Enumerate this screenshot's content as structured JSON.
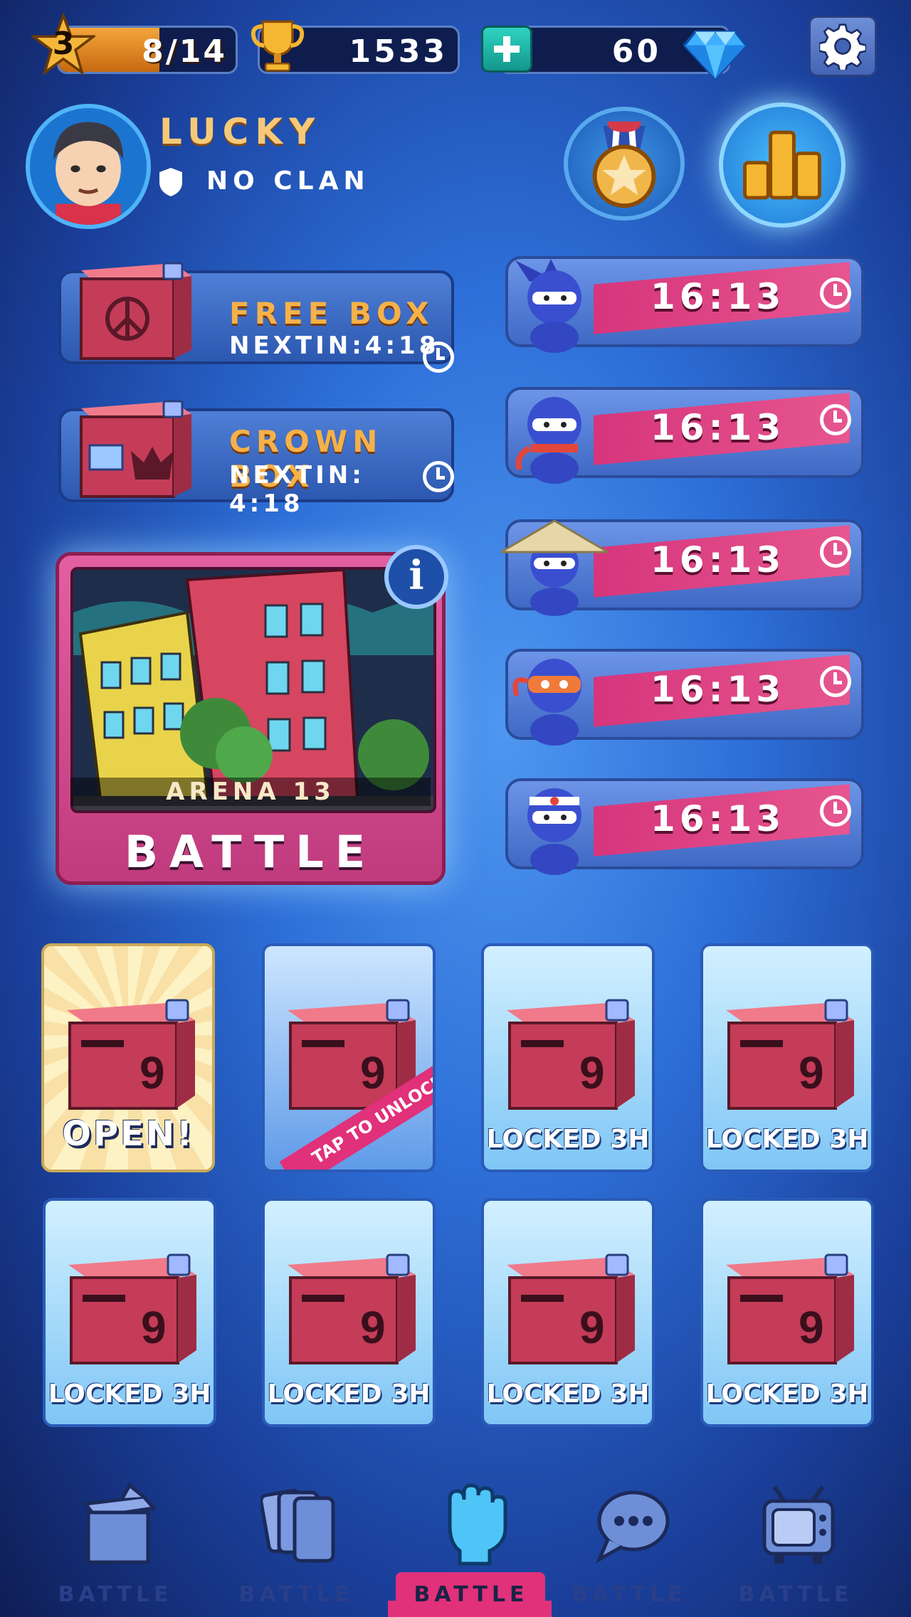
{
  "topbar": {
    "level": "3",
    "xp_text": "8/14",
    "xp_progress": 0.57,
    "trophies": "1533",
    "gems": "60"
  },
  "profile": {
    "name": "LUCKY",
    "clan": "NO CLAN"
  },
  "boxes": [
    {
      "title": "FREE BOX",
      "next": "NEXTIN:4:18",
      "emblem": "peace-icon"
    },
    {
      "title": "CROWN BOX",
      "next": "NEXTIN: 4:18",
      "emblem": "crown-icon"
    }
  ],
  "arena": {
    "label": "ARENA 13",
    "button": "BATTLE",
    "info": "i"
  },
  "timers": [
    {
      "time": "16:13",
      "ninja": "spiky-hair-ninja"
    },
    {
      "time": "16:13",
      "ninja": "red-scarf-ninja"
    },
    {
      "time": "16:13",
      "ninja": "straw-hat-ninja"
    },
    {
      "time": "16:13",
      "ninja": "orange-band-ninja"
    },
    {
      "time": "16:13",
      "ninja": "headband-ninja"
    }
  ],
  "chests": [
    {
      "label": "OPEN!",
      "state": "open",
      "number": "9"
    },
    {
      "label": "",
      "state": "tap",
      "ribbon": "TAP TO UNLOCK",
      "number": "9"
    },
    {
      "label": "LOCKED 3H",
      "state": "locked",
      "number": "9"
    },
    {
      "label": "LOCKED 3H",
      "state": "locked",
      "number": "9"
    },
    {
      "label": "LOCKED 3H",
      "state": "locked",
      "number": "9"
    },
    {
      "label": "LOCKED 3H",
      "state": "locked",
      "number": "9"
    },
    {
      "label": "LOCKED 3H",
      "state": "locked",
      "number": "9"
    },
    {
      "label": "LOCKED 3H",
      "state": "locked",
      "number": "9"
    }
  ],
  "nav": [
    {
      "label": "BATTLE",
      "icon": "box-icon"
    },
    {
      "label": "BATTLE",
      "icon": "cards-icon"
    },
    {
      "label": "BATTLE",
      "icon": "fist-icon",
      "active": true
    },
    {
      "label": "BATTLE",
      "icon": "chat-icon"
    },
    {
      "label": "BATTLE",
      "icon": "tv-icon"
    }
  ],
  "colors": {
    "accent_pink": "#e0317a",
    "gold_text": "#f5b14a",
    "panel_blue": "#3f69c4"
  }
}
